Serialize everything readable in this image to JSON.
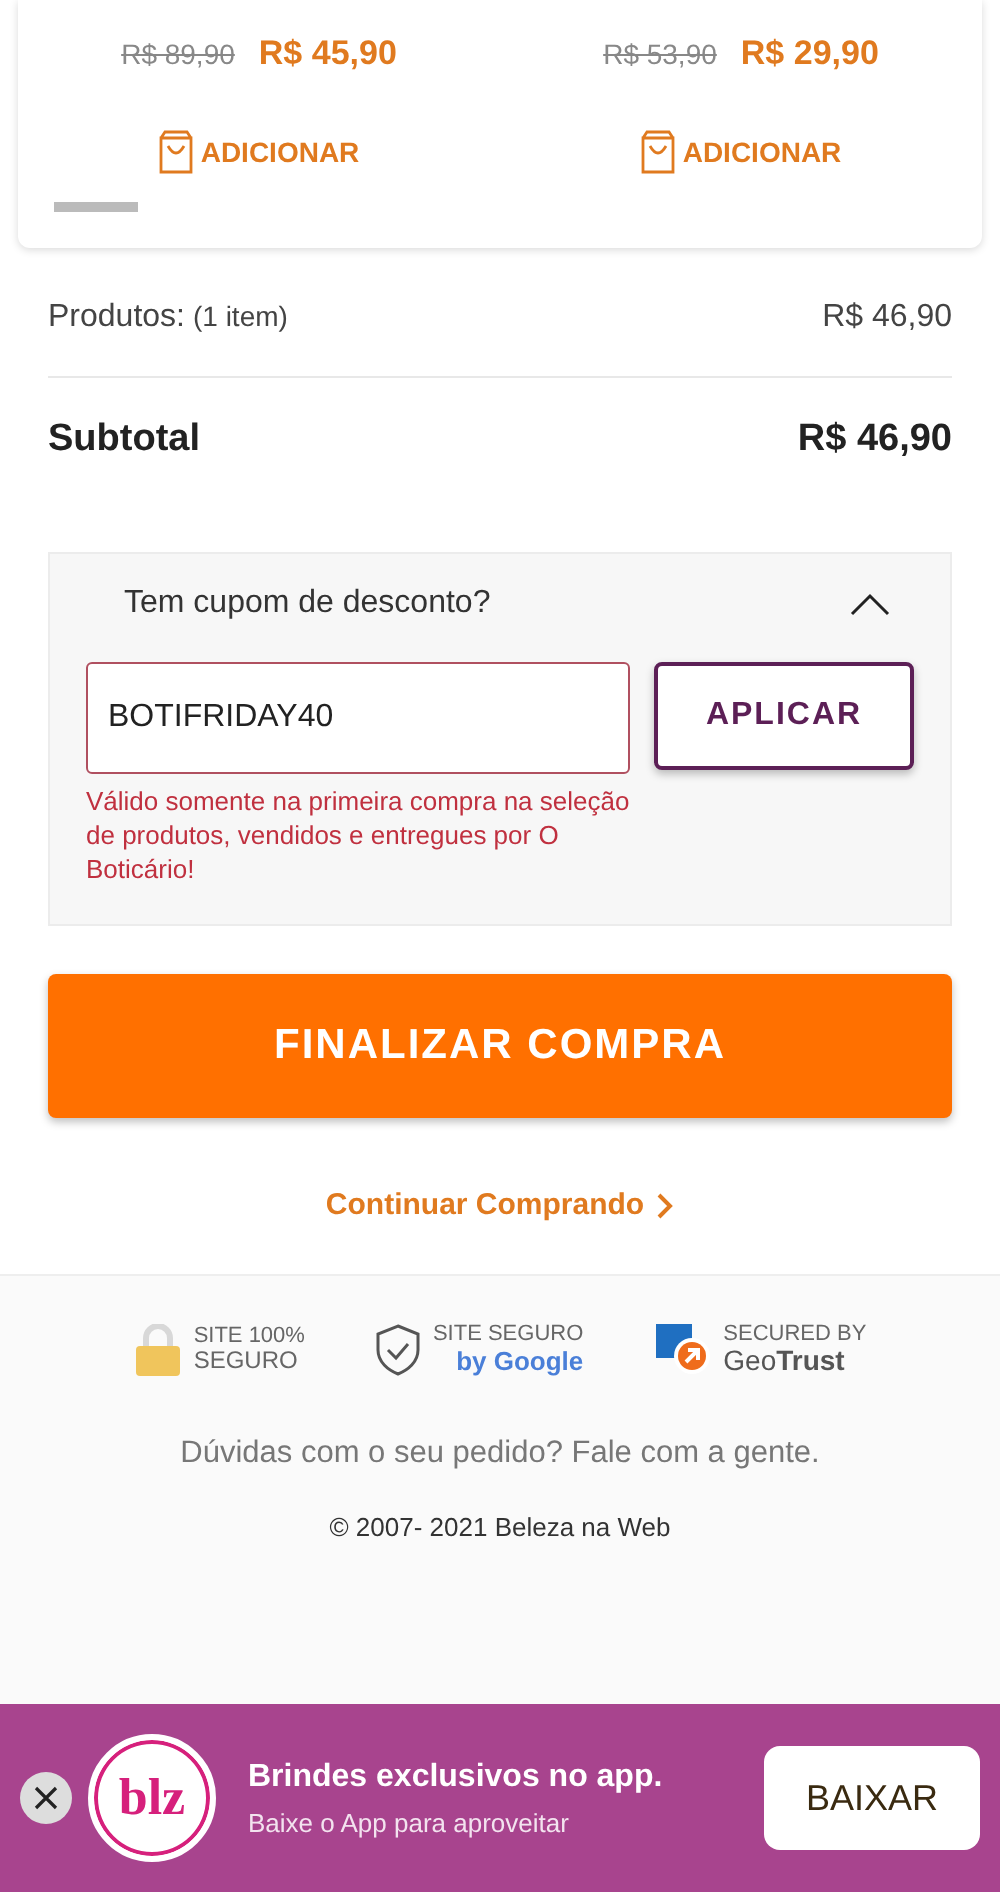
{
  "products": [
    {
      "old_price": "R$ 89,90",
      "price": "R$ 45,90",
      "add_label": "ADICIONAR"
    },
    {
      "old_price": "R$ 53,90",
      "price": "R$ 29,90",
      "add_label": "ADICIONAR"
    }
  ],
  "summary": {
    "products_label": "Produtos:",
    "products_count": "(1 item)",
    "products_value": "R$ 46,90",
    "subtotal_label": "Subtotal",
    "subtotal_value": "R$ 46,90"
  },
  "coupon": {
    "title": "Tem cupom de desconto?",
    "expanded": true,
    "value": "BOTIFRIDAY40",
    "button": "APLICAR",
    "message": "Válido somente na primeira compra na seleção de produtos, vendidos e entregues por O Boticário!"
  },
  "checkout_button": "FINALIZAR COMPRA",
  "continue_link": "Continuar Comprando",
  "seals": [
    {
      "kind": "lock",
      "line1": "SITE 100%",
      "line2": "SEGURO"
    },
    {
      "kind": "shield",
      "line1": "SITE SEGURO",
      "line2": "by Google"
    },
    {
      "kind": "geotrust",
      "line1": "SECURED BY",
      "line2": "Geo**Trust**"
    }
  ],
  "help_text": "Dúvidas com o seu pedido? Fale com a gente.",
  "copyright": "© 2007- 2021 Beleza na Web",
  "app_banner": {
    "logo": "blz",
    "title": "Brindes exclusivos no app.",
    "subtitle": "Baixe o App para aproveitar",
    "button": "BAIXAR"
  }
}
